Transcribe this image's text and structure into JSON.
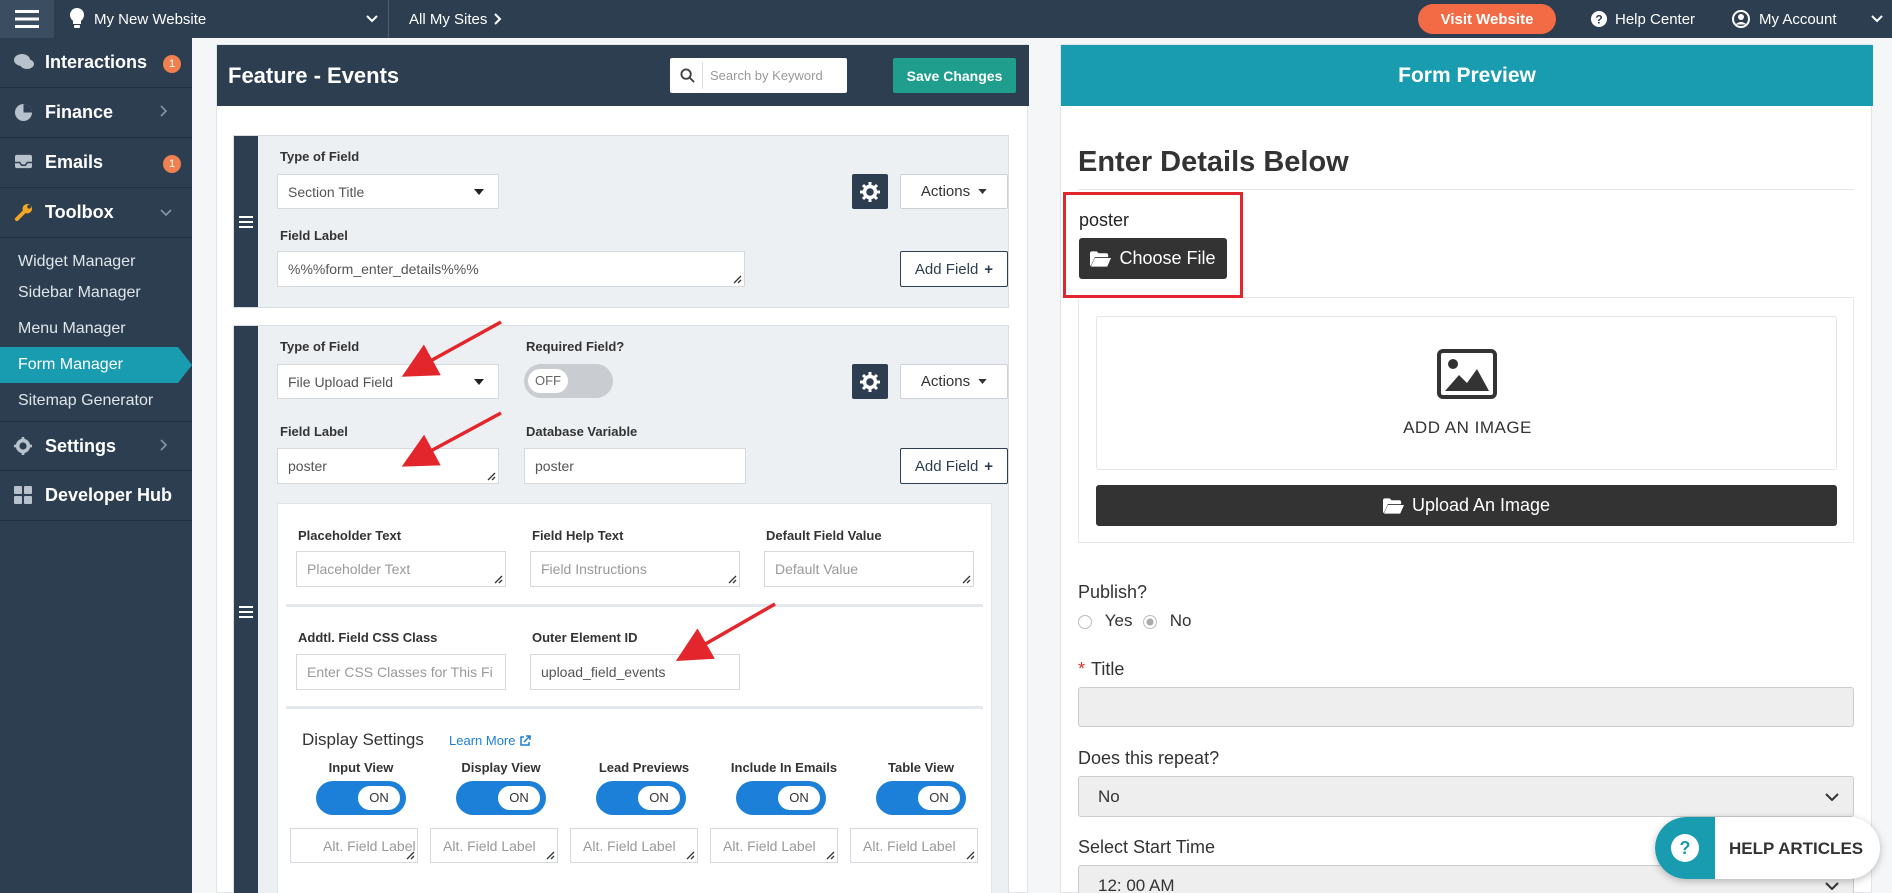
{
  "topbar": {
    "site_name": "My New Website",
    "all_sites": "All My Sites",
    "visit_website": "Visit Website",
    "help_center": "Help Center",
    "my_account": "My Account"
  },
  "sidebar": {
    "items": [
      {
        "label": "Interactions",
        "icon": "chat-icon",
        "badge": "1"
      },
      {
        "label": "Finance",
        "icon": "pie-chart-icon"
      },
      {
        "label": "Emails",
        "icon": "inbox-icon",
        "badge": "1"
      },
      {
        "label": "Toolbox",
        "icon": "wrench-icon"
      }
    ],
    "subitems": [
      "Widget Manager",
      "Sidebar Manager",
      "Menu Manager",
      "Form Manager",
      "Sitemap Generator"
    ],
    "active_subitem": "Form Manager",
    "bottom_items": [
      {
        "label": "Settings",
        "icon": "gear-icon"
      },
      {
        "label": "Developer Hub",
        "icon": "grid-icon"
      }
    ]
  },
  "editor": {
    "title": "Feature - Events",
    "search_placeholder": "Search by Keyword",
    "save_label": "Save Changes",
    "field1": {
      "type_label": "Type of Field",
      "type_value": "Section Title",
      "label_label": "Field Label",
      "label_value": "%%%form_enter_details%%%",
      "actions": "Actions",
      "add_field": "Add Field"
    },
    "field2": {
      "type_label": "Type of Field",
      "type_value": "File Upload Field",
      "required_label": "Required Field?",
      "required_value": "OFF",
      "label_label": "Field Label",
      "label_value": "poster",
      "dbvar_label": "Database Variable",
      "dbvar_value": "poster",
      "actions": "Actions",
      "add_field": "Add Field",
      "placeholder_label": "Placeholder Text",
      "placeholder_ph": "Placeholder Text",
      "help_label": "Field Help Text",
      "help_ph": "Field Instructions",
      "default_label": "Default Field Value",
      "default_ph": "Default Value",
      "css_label": "Addtl. Field CSS Class",
      "css_ph": "Enter CSS Classes for This Fi",
      "outer_label": "Outer Element ID",
      "outer_value": "upload_field_events",
      "display_settings": "Display Settings",
      "learn_more": "Learn More",
      "toggles": [
        {
          "label": "Input View",
          "value": "ON",
          "alt": "Alt. Field Label"
        },
        {
          "label": "Display View",
          "value": "ON",
          "alt": "Alt. Field Label"
        },
        {
          "label": "Lead Previews",
          "value": "ON",
          "alt": "Alt. Field Label"
        },
        {
          "label": "Include In Emails",
          "value": "ON",
          "alt": "Alt. Field Label"
        },
        {
          "label": "Table View",
          "value": "ON",
          "alt": "Alt. Field Label"
        }
      ]
    }
  },
  "preview": {
    "header": "Form Preview",
    "heading": "Enter Details Below",
    "file_label": "poster",
    "choose_file": "Choose File",
    "add_image": "ADD AN IMAGE",
    "upload_image": "Upload An Image",
    "publish_label": "Publish?",
    "yes": "Yes",
    "no": "No",
    "required_mark": "*",
    "title_label": "Title",
    "repeat_label": "Does this repeat?",
    "repeat_value": "No",
    "start_label": "Select Start Time",
    "start_value": "12: 00 AM"
  },
  "help_articles": "HELP ARTICLES",
  "colors": {
    "navy": "#2c3e50",
    "teal": "#1a9cb0",
    "accent_orange": "#f26b45",
    "toggle_blue": "#1c7fd8",
    "annotation_red": "#e3262b"
  }
}
